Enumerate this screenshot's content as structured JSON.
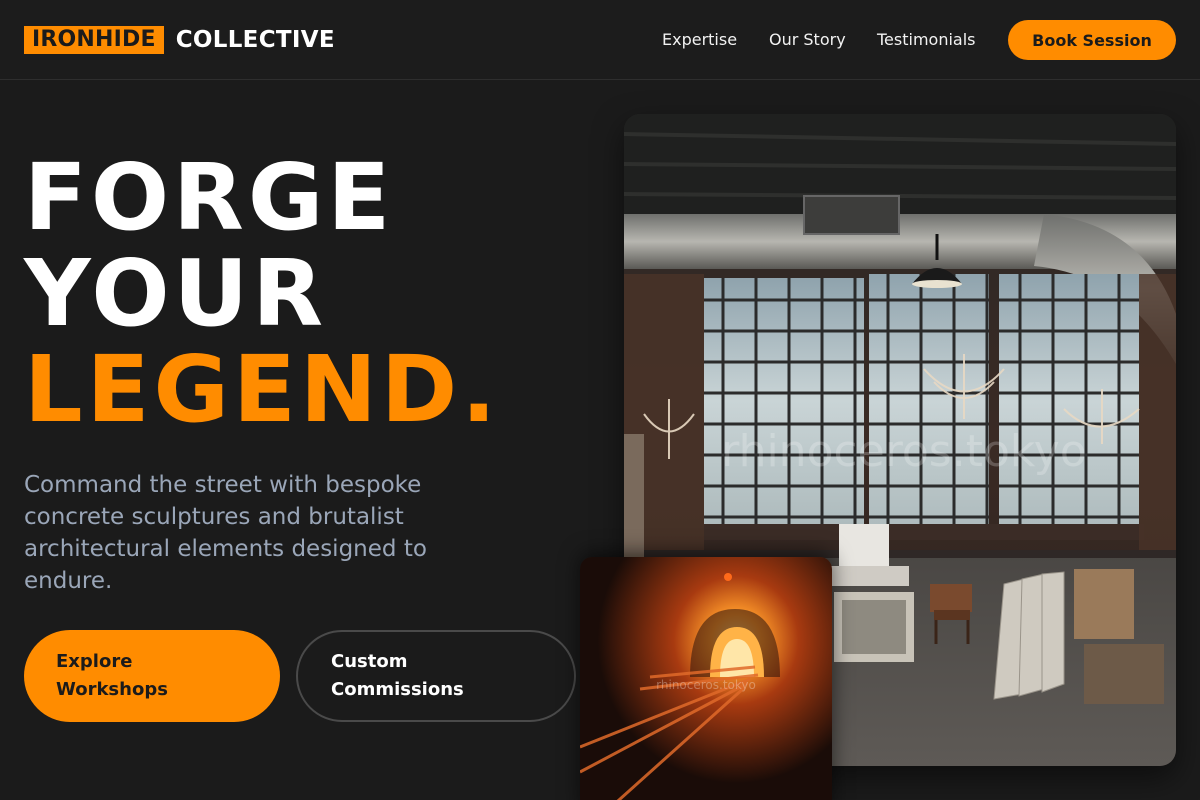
{
  "brand": {
    "highlight": "IRONHIDE",
    "word": "COLLECTIVE"
  },
  "nav": {
    "items": [
      {
        "label": "Expertise"
      },
      {
        "label": "Our Story"
      },
      {
        "label": "Testimonials"
      }
    ],
    "cta": "Book Session"
  },
  "hero": {
    "line1": "FORGE",
    "line2": "YOUR",
    "line3": "LEGEND.",
    "subtitle": "Command the street with bespoke concrete sculptures and brutalist architectural elements designed to endure.",
    "primary_button": "Explore Workshops",
    "secondary_button": "Custom Commissions"
  },
  "images": {
    "main_watermark": "rhinoceros.tokyo",
    "small_watermark": "rhinoceros.tokyo"
  },
  "colors": {
    "accent": "#ff8c00",
    "background": "#1b1b1b",
    "subtitle": "#9aa6b8"
  }
}
